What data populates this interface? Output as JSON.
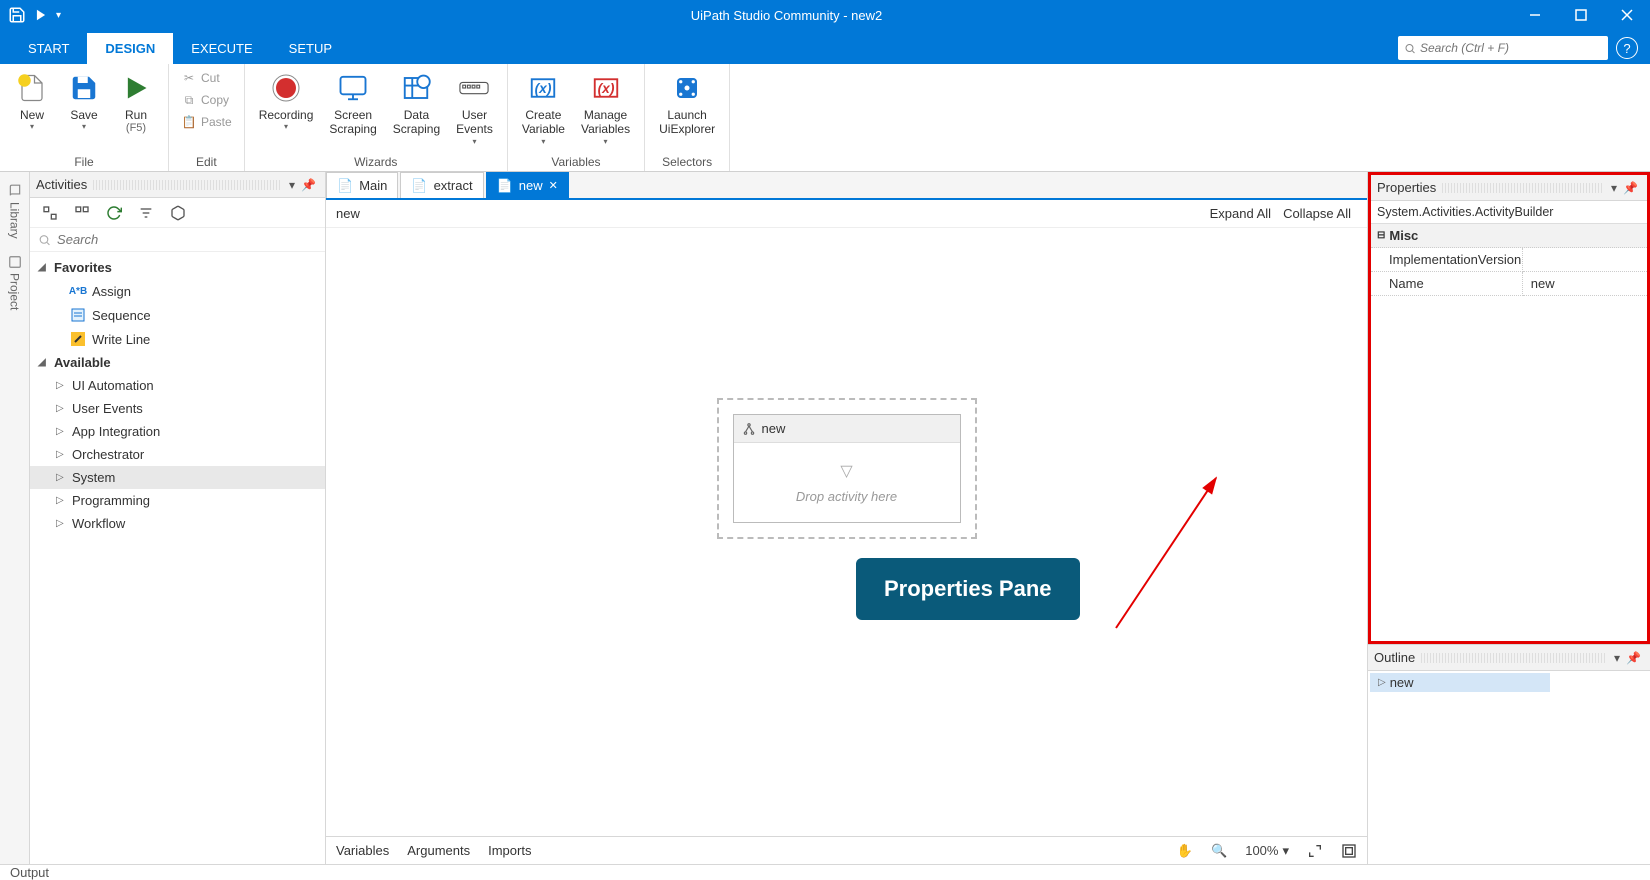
{
  "title": "UiPath Studio Community - new2",
  "ribbon_tabs": {
    "start": "START",
    "design": "DESIGN",
    "execute": "EXECUTE",
    "setup": "SETUP"
  },
  "search_placeholder": "Search (Ctrl + F)",
  "ribbon": {
    "new": "New",
    "save": "Save",
    "run": "Run",
    "run_sub": "(F5)",
    "cut": "Cut",
    "copy": "Copy",
    "paste": "Paste",
    "recording": "Recording",
    "screen_scraping": "Screen\nScraping",
    "data_scraping": "Data\nScraping",
    "user_events": "User\nEvents",
    "create_var": "Create\nVariable",
    "manage_var": "Manage\nVariables",
    "launch_uiexplorer": "Launch\nUiExplorer",
    "group_file": "File",
    "group_edit": "Edit",
    "group_wizards": "Wizards",
    "group_variables": "Variables",
    "group_selectors": "Selectors"
  },
  "left_vertical": {
    "library": "Library",
    "project": "Project"
  },
  "activities": {
    "title": "Activities",
    "search": "Search",
    "favorites": "Favorites",
    "assign": "Assign",
    "sequence": "Sequence",
    "writeline": "Write Line",
    "available": "Available",
    "ui_automation": "UI Automation",
    "user_events": "User Events",
    "app_integration": "App Integration",
    "orchestrator": "Orchestrator",
    "system": "System",
    "programming": "Programming",
    "workflow": "Workflow"
  },
  "doc_tabs": {
    "main": "Main",
    "extract": "extract",
    "new": "new"
  },
  "breadcrumb": {
    "current": "new",
    "expand": "Expand All",
    "collapse": "Collapse All"
  },
  "canvas": {
    "activity_name": "new",
    "drop_hint": "Drop activity here"
  },
  "designer_footer": {
    "variables": "Variables",
    "arguments": "Arguments",
    "imports": "Imports",
    "zoom": "100%"
  },
  "properties": {
    "title": "Properties",
    "class": "System.Activities.ActivityBuilder",
    "misc": "Misc",
    "impl_version": "ImplementationVersion",
    "name_k": "Name",
    "name_v": "new"
  },
  "outline": {
    "title": "Outline",
    "item": "new"
  },
  "output": "Output",
  "annotation": "Properties Pane"
}
